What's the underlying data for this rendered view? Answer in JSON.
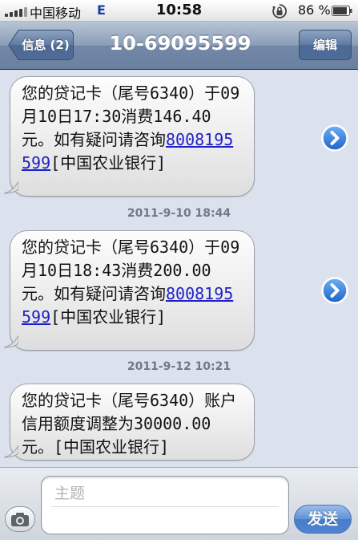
{
  "status_bar": {
    "carrier": "中国移动",
    "network": "E",
    "time": "10:58",
    "battery": "86 %",
    "icons": [
      "signal-bars-icon",
      "rotation-lock-icon",
      "battery-icon"
    ]
  },
  "nav": {
    "back_label": "信息 (2)",
    "title": "10-69095599",
    "edit_label": "编辑"
  },
  "messages": [
    {
      "text_before": "您的贷记卡（尾号6340）于09月10日17:30消费146.40元。如有疑问请咨询",
      "link": "8008195599",
      "text_after": "[中国农业银行]"
    },
    {
      "text_before": "您的贷记卡（尾号6340）于09月10日18:43消费200.00元。如有疑问请咨询",
      "link": "8008195599",
      "text_after": "[中国农业银行]"
    },
    {
      "text_before": "您的贷记卡（尾号6340）账户信用额度调整为30000.00元。[中国农业银行]",
      "link": "",
      "text_after": ""
    }
  ],
  "timestamps": [
    "2011-9-10 18:44",
    "2011-9-12 10:21"
  ],
  "compose": {
    "subject_placeholder": "主题",
    "send_label": "发送"
  },
  "colors": {
    "nav_bar": "#7388a7",
    "link": "#2020c8",
    "detail_chevron": "#2f7fe0",
    "send_button": "#3977d0"
  }
}
